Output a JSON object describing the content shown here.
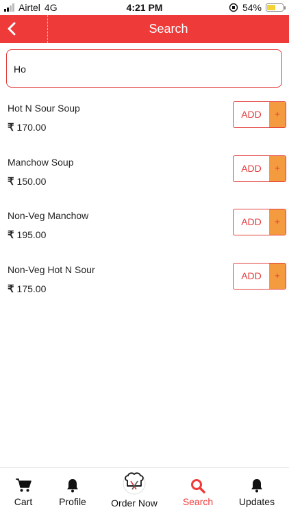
{
  "status_bar": {
    "carrier": "Airtel",
    "network": "4G",
    "time": "4:21 PM",
    "battery": "54%",
    "battery_level": 0.54,
    "battery_color": "#f3d23a"
  },
  "header": {
    "title": "Search",
    "back_icon": "chevron-left-icon",
    "color": "#ef3a3a"
  },
  "search": {
    "value": "Ho"
  },
  "results": [
    {
      "name": "Hot N Sour Soup",
      "price": "170.00",
      "add_label": "ADD",
      "plus": "+"
    },
    {
      "name": "Manchow Soup",
      "price": "150.00",
      "add_label": "ADD",
      "plus": "+"
    },
    {
      "name": "Non-Veg Manchow",
      "price": "195.00",
      "add_label": "ADD",
      "plus": "+"
    },
    {
      "name": "Non-Veg Hot N Sour",
      "price": "175.00",
      "add_label": "ADD",
      "plus": "+"
    }
  ],
  "currency_symbol": "₹",
  "bottom_nav": {
    "active": "search",
    "items": [
      {
        "label": "Cart",
        "icon": "cart-icon"
      },
      {
        "label": "Profile",
        "icon": "bell-icon"
      },
      {
        "label": "Order Now",
        "icon": "chef-hat-icon"
      },
      {
        "label": "Search",
        "icon": "search-icon"
      },
      {
        "label": "Updates",
        "icon": "bell-icon"
      }
    ]
  }
}
